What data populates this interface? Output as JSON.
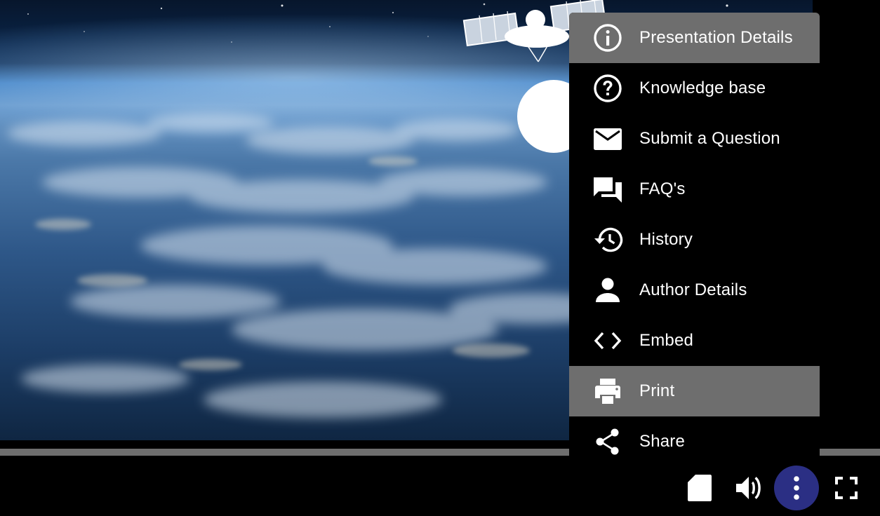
{
  "menu": {
    "items": [
      {
        "label": "Presentation Details",
        "icon": "info-icon",
        "active": true
      },
      {
        "label": "Knowledge base",
        "icon": "help-circle-icon",
        "active": false
      },
      {
        "label": "Submit a Question",
        "icon": "mail-icon",
        "active": false
      },
      {
        "label": "FAQ's",
        "icon": "chat-bubbles-icon",
        "active": false
      },
      {
        "label": "History",
        "icon": "history-icon",
        "active": false
      },
      {
        "label": "Author Details",
        "icon": "person-icon",
        "active": false
      },
      {
        "label": "Embed",
        "icon": "code-icon",
        "active": false
      },
      {
        "label": "Print",
        "icon": "printer-icon",
        "active": true
      },
      {
        "label": "Share",
        "icon": "share-icon",
        "active": false
      }
    ]
  },
  "controls": {
    "notes_icon": "document-icon",
    "volume_icon": "volume-icon",
    "more_icon": "more-vertical-icon",
    "fullscreen_icon": "fullscreen-icon"
  },
  "colors": {
    "menu_background": "#000000",
    "menu_highlight": "#6e6e6e",
    "more_button": "#2b2f84",
    "progress_track": "#6e6e6e",
    "icon": "#ffffff"
  }
}
